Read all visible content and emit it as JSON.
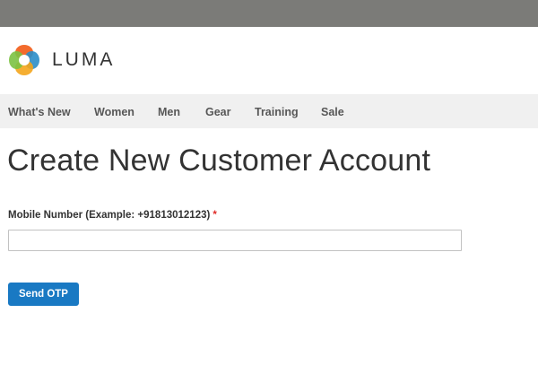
{
  "topbar": {
    "color": "#7b7b78"
  },
  "header": {
    "logo_text": "LUMA",
    "logo_icon": "luma-logo-icon"
  },
  "nav": {
    "items": [
      {
        "label": "What's New"
      },
      {
        "label": "Women"
      },
      {
        "label": "Men"
      },
      {
        "label": "Gear"
      },
      {
        "label": "Training"
      },
      {
        "label": "Sale"
      }
    ]
  },
  "main": {
    "title": "Create New Customer Account",
    "mobile_field": {
      "label": "Mobile Number (Example: +91813012123)",
      "required_mark": "*",
      "value": "",
      "placeholder": ""
    },
    "send_otp_label": "Send OTP"
  },
  "colors": {
    "primary_button": "#1979c3",
    "required": "#e02b27",
    "nav_background": "#f0f0f0"
  }
}
